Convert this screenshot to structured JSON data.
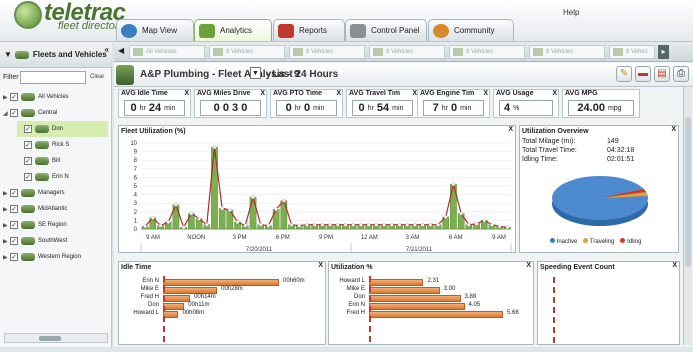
{
  "app": {
    "logo_name": "teletrac",
    "logo_sub": "fleet director",
    "help": "Help"
  },
  "tabs": [
    {
      "label": "Map View",
      "color": "#3a7fc0"
    },
    {
      "label": "Analytics",
      "color": "#6aa33a"
    },
    {
      "label": "Reports",
      "color": "#c0392b"
    },
    {
      "label": "Control Panel",
      "color": "#8a8f93"
    },
    {
      "label": "Community",
      "color": "#d68a2a"
    }
  ],
  "left": {
    "title": "Fleets and Vehicles",
    "filter_label": "Filter",
    "filter_value": "",
    "clear": "Clear",
    "tree": [
      {
        "label": "All Vehicles",
        "level": 0,
        "arrow": "▶",
        "checked": true,
        "selected": false
      },
      {
        "label": "Central",
        "level": 0,
        "arrow": "◢",
        "checked": true,
        "selected": false
      },
      {
        "label": "Don",
        "level": 1,
        "arrow": "",
        "checked": true,
        "selected": true
      },
      {
        "label": "Rick S",
        "level": 1,
        "arrow": "",
        "checked": true,
        "selected": false
      },
      {
        "label": "Bill",
        "level": 1,
        "arrow": "",
        "checked": true,
        "selected": false
      },
      {
        "label": "Erin N",
        "level": 1,
        "arrow": "",
        "checked": true,
        "selected": false
      },
      {
        "label": "Managers",
        "level": 0,
        "arrow": "▶",
        "checked": true,
        "selected": false
      },
      {
        "label": "MidAtlantic",
        "level": 0,
        "arrow": "▶",
        "checked": true,
        "selected": false
      },
      {
        "label": "SE Region",
        "level": 0,
        "arrow": "▶",
        "checked": true,
        "selected": false
      },
      {
        "label": "SouthWest",
        "level": 0,
        "arrow": "▶",
        "checked": true,
        "selected": false
      },
      {
        "label": "Western Region",
        "level": 0,
        "arrow": "▶",
        "checked": true,
        "selected": false
      }
    ]
  },
  "vsbar": {
    "items": [
      "All Vehicles",
      "9 Vehicles",
      "9 Vehicles",
      "9 Vehicles",
      "9 Vehicles",
      "9 Vehicles",
      "9 Vehicl"
    ]
  },
  "titlebar": {
    "title": "A&P Plumbing - Fleet Analysis  - 9",
    "period": "- Last 24 Hours",
    "dd": "▼"
  },
  "toolbar": {
    "edit": "✎",
    "minus": "▬",
    "pdf": "▤",
    "print": "⎙"
  },
  "kpis": [
    {
      "title": "AVG Idle Time",
      "close": "X",
      "v1": "0",
      "u1": "hr",
      "v2": "24",
      "u2": "min"
    },
    {
      "title": "AVG Miles Drive",
      "close": "X",
      "v1": "0 0 3 0",
      "u1": "",
      "v2": "",
      "u2": ""
    },
    {
      "title": "AVG PTO Time",
      "close": "X",
      "v1": "0",
      "u1": "hr",
      "v2": "0",
      "u2": "min"
    },
    {
      "title": "AVG Travel Tim",
      "close": "X",
      "v1": "0",
      "u1": "hr",
      "v2": "54",
      "u2": "min"
    },
    {
      "title": "AVG Engine Tim",
      "close": "X",
      "v1": "7",
      "u1": "hr",
      "v2": "0",
      "u2": "min"
    },
    {
      "title": "AVG Usage",
      "close": "X",
      "v1": "4",
      "u1": "%",
      "v2": "",
      "u2": ""
    },
    {
      "title": "AVG MPG",
      "close": "X",
      "v1": "24.00",
      "u1": "mpg",
      "v2": "",
      "u2": ""
    }
  ],
  "utilization_chart": {
    "title": "Fleet Utilization (%)",
    "close": "X"
  },
  "overview": {
    "title": "Utilization Overview",
    "close": "X",
    "rows": [
      {
        "label": "Total Milage (mi):",
        "value": "149"
      },
      {
        "label": "Total Travel Time:",
        "value": "04:32:18"
      },
      {
        "label": "Idling Time:",
        "value": "02:01:51"
      }
    ],
    "legend": [
      {
        "label": "Inactive",
        "color": "#3b7dc4"
      },
      {
        "label": "Traveling",
        "color": "#e0a23a"
      },
      {
        "label": "Idling",
        "color": "#d0382b"
      }
    ]
  },
  "idle_time": {
    "title": "Idle Time",
    "close": "X"
  },
  "utilization_pct": {
    "title": "Utilization %",
    "close": "X"
  },
  "speeding": {
    "title": "Speeding Event Count",
    "close": "X"
  },
  "chart_data": [
    {
      "type": "bar",
      "title": "Fleet Utilization (%)",
      "x_ticks": [
        "9 AM",
        "NOON",
        "3 PM",
        "6 PM",
        "9 PM",
        "12 AM",
        "3 AM",
        "6 AM",
        "9 AM"
      ],
      "date_labels": [
        "7/20/2011",
        "7/21/2011"
      ],
      "ylim": [
        0,
        10
      ],
      "yticks": [
        0,
        1,
        2,
        3,
        4,
        5,
        6,
        7,
        8,
        9,
        10
      ],
      "values": [
        0.3,
        1.3,
        0.4,
        0.8,
        2.8,
        0.2,
        1.8,
        1.2,
        0.5,
        9.5,
        2.4,
        2.2,
        0.8,
        0.4,
        3.7,
        0.5,
        0.4,
        2.3,
        3.3,
        0.5,
        0.4,
        0.5,
        0.5,
        0.5,
        0.5,
        0.5,
        0.5,
        0.5,
        0.5,
        0.5,
        0.5,
        0.5,
        0.5,
        0.5,
        0.5,
        0.5,
        0.5,
        0.5,
        0.5,
        1.4,
        5.2,
        1.8,
        0.5,
        0.6,
        1.0,
        0.5,
        0.3,
        0.2
      ],
      "series_colors": {
        "bar": "#7cb04e",
        "line": "#b02a2a"
      }
    },
    {
      "type": "pie",
      "title": "Utilization Overview",
      "labels": [
        "Inactive",
        "Traveling",
        "Idling"
      ],
      "values": [
        96,
        3,
        1
      ]
    },
    {
      "type": "bar",
      "title": "Idle Time",
      "categories": [
        "Erin N",
        "Mike E",
        "Fred H",
        "Don",
        "Howard L"
      ],
      "values": [
        60,
        28,
        14,
        11,
        8
      ],
      "data_labels": [
        "00h60m",
        "00h28m",
        "00h14m",
        "00h11m",
        "00h08m"
      ]
    },
    {
      "type": "bar",
      "title": "Utilization %",
      "categories": [
        "Howard L",
        "Mike E",
        "Don",
        "Erin N",
        "Fred H"
      ],
      "values": [
        2.31,
        3.0,
        3.88,
        4.05,
        5.68
      ],
      "data_labels": [
        "2.31",
        "3.00",
        "3.88",
        "4.05",
        "5.68"
      ]
    }
  ]
}
